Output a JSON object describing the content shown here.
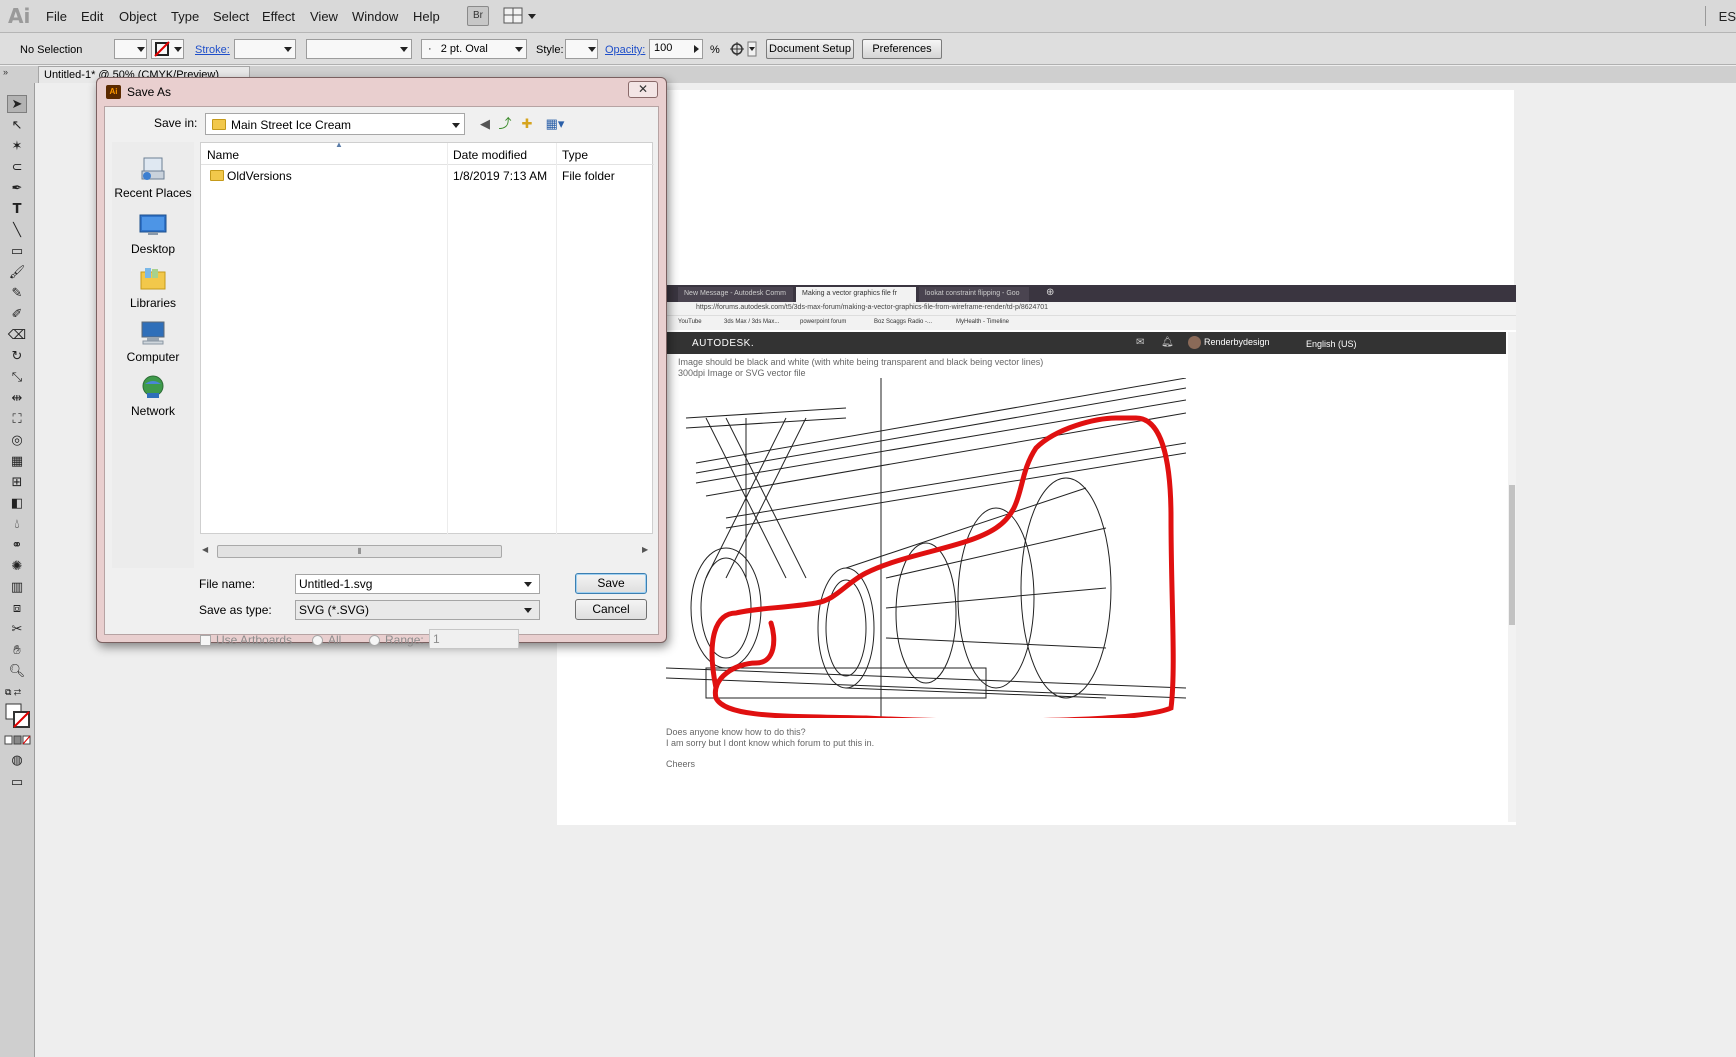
{
  "app": {
    "logo": "Ai",
    "menus": [
      "File",
      "Edit",
      "Object",
      "Type",
      "Select",
      "Effect",
      "View",
      "Window",
      "Help"
    ],
    "bridge_label": "Br",
    "workspace_label": "ES"
  },
  "control_bar": {
    "selection": "No Selection",
    "stroke_label": "Stroke:",
    "brush": "2 pt. Oval",
    "brush_bullet": "·",
    "style_label": "Style:",
    "opacity_label": "Opacity:",
    "opacity_value": "100",
    "opacity_unit": "%",
    "document_setup": "Document Setup",
    "preferences": "Preferences"
  },
  "document": {
    "tab_title": "Untitled-1* @ 50% (CMYK/Preview)",
    "tab_close": "×"
  },
  "browser": {
    "tabs": [
      "New Message - Autodesk Comm",
      "Making a vector graphics file fr",
      "lookat constraint flipping - Goo"
    ],
    "url": "https://forums.autodesk.com/t5/3ds-max-forum/making-a-vector-graphics-file-from-wireframe-render/td-p/8624701",
    "bookmarks": [
      "YouTube",
      "3ds Max / 3ds Max...",
      "powerpoint forum",
      "Boz Scaggs Radio -...",
      "MyHealth - Timeline"
    ],
    "brand": "AUTODESK.",
    "username": "Renderbydesign",
    "language": "English (US)",
    "bullet_1": "Image should be black and white (with white being transparent and black being vector lines)",
    "bullet_2": "300dpi Image or SVG vector file",
    "question_1": "Does anyone know how to do this?",
    "question_2": "I am sorry but I dont know which forum to put this in.",
    "signoff": "Cheers"
  },
  "dialog": {
    "title": "Save As",
    "ai_badge": "Ai",
    "close": "✕",
    "save_in_label": "Save in:",
    "save_in_value": "Main Street Ice Cream",
    "places": [
      "Recent Places",
      "Desktop",
      "Libraries",
      "Computer",
      "Network"
    ],
    "columns": [
      "Name",
      "Date modified",
      "Type"
    ],
    "files": [
      {
        "name": "OldVersions",
        "date": "1/8/2019 7:13 AM",
        "type": "File folder"
      }
    ],
    "file_name_label": "File name:",
    "file_name_value": "Untitled-1.svg",
    "save_as_type_label": "Save as type:",
    "save_as_type_value": "SVG (*.SVG)",
    "save_button": "Save",
    "cancel_button": "Cancel",
    "use_artboards": "Use Artboards",
    "all_label": "All",
    "range_label": "Range:",
    "range_value": "1"
  },
  "colors": {
    "accent_link": "#1f4fc9",
    "dialog_frame": "#e9cfcf",
    "folder": "#f2c84b",
    "annotation_red": "#e01010"
  }
}
